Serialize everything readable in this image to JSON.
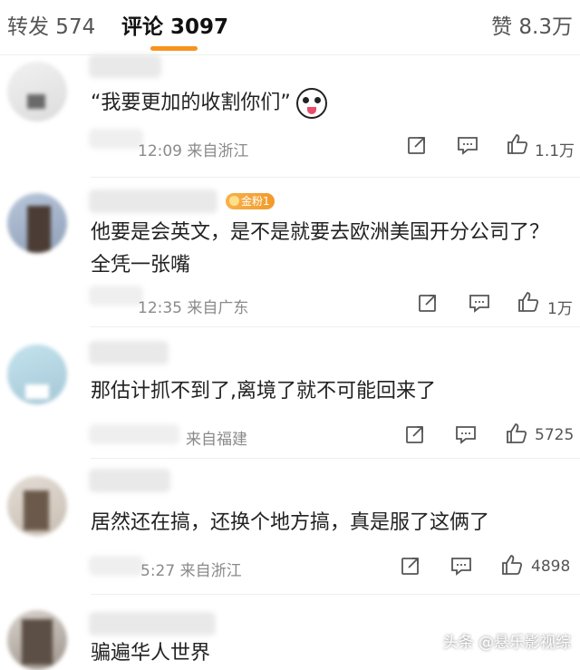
{
  "tabs": {
    "repost": "转发 574",
    "comments": "评论 3097",
    "likes": "赞 8.3万"
  },
  "comments": [
    {
      "text": "“我要更加的收割你们”",
      "emoji": "panda-tongue-emoji",
      "meta": "12:09 来自浙江",
      "likes": "1.1万"
    },
    {
      "badge": "金粉1",
      "text": "他要是会英文，是不是就要去欧洲美国开分公司了？全凭一张嘴",
      "meta": "12:35 来自广东",
      "likes": "1万"
    },
    {
      "text": "那估计抓不到了,离境了就不可能回来了",
      "meta": "来自福建",
      "likes": "5725"
    },
    {
      "text": "居然还在搞，还换个地方搞，真是服了这俩了",
      "meta": "5:27 来自浙江",
      "likes": "4898"
    },
    {
      "text": "骗遍华人世界"
    }
  ],
  "watermark": "头条 @悬乐影视综",
  "colors": {
    "accent": "#f7931e",
    "badge": "#f29a2a"
  }
}
